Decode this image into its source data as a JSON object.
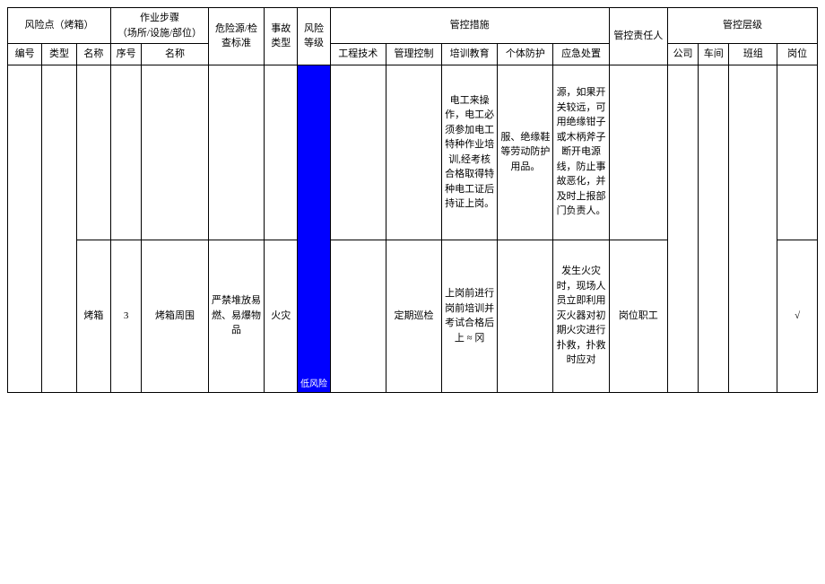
{
  "chart_data": {
    "type": "table",
    "title": "风险点（烤箱）管控表",
    "columns": [
      "编号",
      "类型",
      "名称",
      "序号",
      "名称",
      "危险源/检查标准",
      "事故类型",
      "风险等级",
      "工程技术",
      "管理控制",
      "培训教育",
      "个体防护",
      "应急处置",
      "管控责任人",
      "公司",
      "车间",
      "班组",
      "岗位"
    ],
    "rows": [
      [
        "",
        "",
        "",
        "",
        "",
        "",
        "",
        "",
        "",
        "",
        "电工来操作，电工必须参加电工特种作业培训,经考核合格取得特种电工证后持证上岗。",
        "服、绝缘鞋等劳动防护用品。",
        "源，如果开关较远，可用绝缘钳子或木柄斧子断开电源线，防止事故恶化，并及时上报部门负责人。",
        "",
        "",
        "",
        "",
        ""
      ],
      [
        "",
        "",
        "烤箱",
        "3",
        "烤箱周围",
        "严禁堆放易燃、易爆物品",
        "火灾",
        "低风险",
        "",
        "定期巡检",
        "上岗前进行岗前培训并考试合格后上 ≈ 冈",
        "",
        "发生火灾时，现场人员立即利用灭火器对初期火灾进行扑救，扑救时应对",
        "岗位职工",
        "",
        "",
        "",
        "√"
      ]
    ]
  },
  "headers": {
    "riskpoint": "风险点（烤箱）",
    "worksteps": "作业步骤\n（场所/设施/部位）",
    "hazard": "危险源/检查标准",
    "accident": "事故类型",
    "risklevel": "风险等级",
    "measures": "管控措施",
    "responsible": "管控责任人",
    "levels": "管控层级",
    "idx": "编号",
    "type": "类型",
    "name": "名称",
    "seq": "序号",
    "stepname": "名称",
    "eng": "工程技术",
    "mgmt": "管理控制",
    "train": "培训教育",
    "ppe": "个体防护",
    "emerg": "应急处置",
    "co": "公司",
    "ws": "车间",
    "team": "班组",
    "post": "岗位"
  },
  "row1": {
    "train": "电工来操作，电工必须参加电工特种作业培训,经考核合格取得特种电工证后持证上岗。",
    "ppe": "服、绝缘鞋等劳动防护用品。",
    "emerg": "源，如果开关较远，可用绝缘钳子或木柄斧子断开电源线，防止事故恶化，并及时上报部门负责人。"
  },
  "row2": {
    "name": "烤箱",
    "seq": "3",
    "stepname": "烤箱周围",
    "hazard": "严禁堆放易燃、易爆物品",
    "accident": "火灾",
    "risklabel": "低风险",
    "mgmt": "定期巡检",
    "train": "上岗前进行岗前培训并考试合格后上 ≈ 冈",
    "emerg": "发生火灾时，现场人员立即利用灭火器对初期火灾进行扑救，扑救时应对",
    "resp": "岗位职工",
    "post": "√"
  }
}
